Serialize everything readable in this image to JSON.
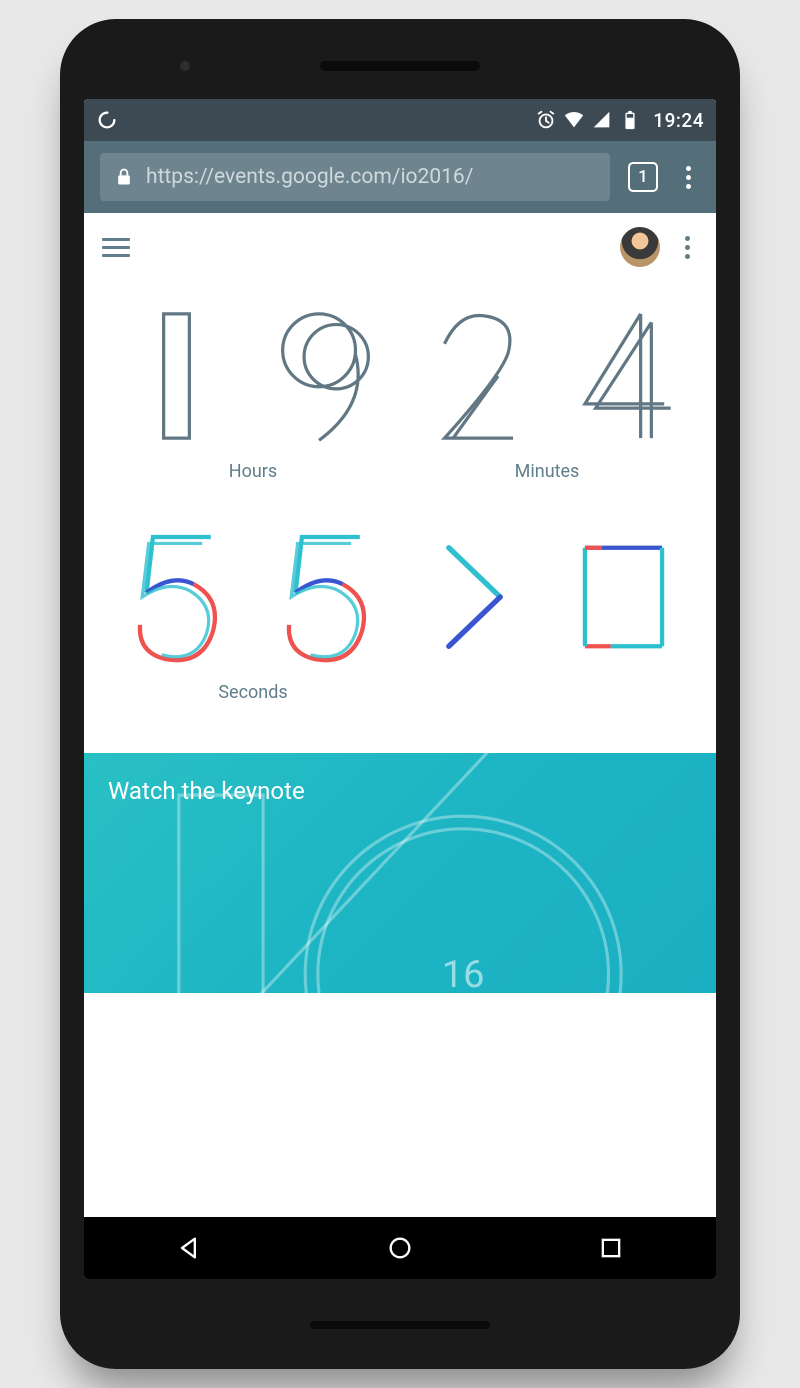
{
  "status": {
    "time": "19:24"
  },
  "browser": {
    "url": "https://events.google.com/io2016/",
    "tab_count": "1"
  },
  "page": {
    "countdown": {
      "hours_label": "Hours",
      "minutes_label": "Minutes",
      "seconds_label": "Seconds",
      "hours": "19",
      "minutes": "24",
      "seconds": "55"
    },
    "keynote": {
      "title": "Watch the keynote",
      "year_badge": "16"
    }
  }
}
